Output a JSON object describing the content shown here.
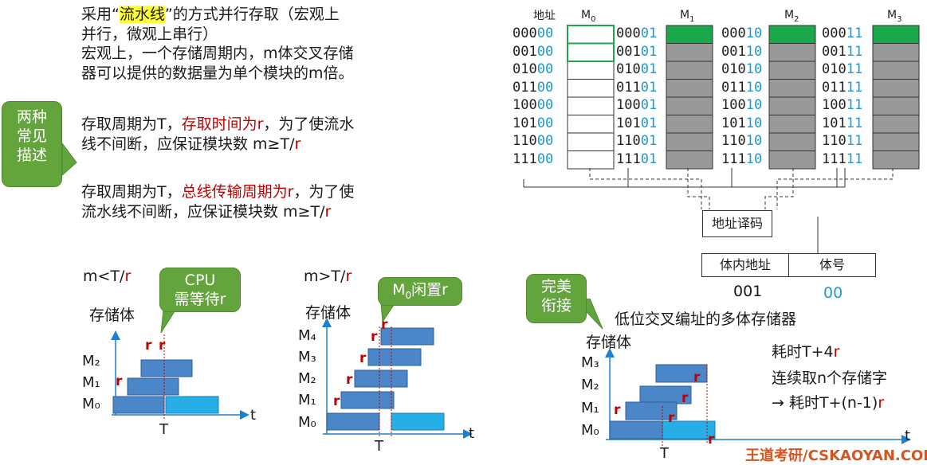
{
  "para1_pre": "采用“",
  "para1_hl": "流水线",
  "para1_post": "”的方式并行存取（宏观上",
  "para1_line2": "并行，微观上串行）",
  "para2_line1": "宏观上，一个存储周期内，m体交叉存储",
  "para2_line2": "器可以提供的数据量为单个模块的m倍。",
  "para3_pre": "存取周期为T，",
  "para3_red": "存取时间为r",
  "para3_post": "，为了使流水",
  "para3_line2_pre": "线不间断，应保证模块数 m≥T/",
  "para3_line2_red": "r",
  "para4_pre": "存取周期为T，",
  "para4_red": "总线传输周期为r",
  "para4_post": "，为了使",
  "para4_line2_pre": "流水线不间断，应保证模块数 m≥T/",
  "para4_line2_red": "r",
  "bubble_desc": [
    "两种",
    "常见",
    "描述"
  ],
  "tl1": {
    "cond_pre": "m<T/",
    "cond_red": "r",
    "bubble": [
      "CPU",
      "需等待r"
    ],
    "title": "存储体",
    "modules": [
      "M₂",
      "M₁",
      "M₀"
    ],
    "r": "r",
    "t": "t",
    "T": "T"
  },
  "tl2": {
    "cond_pre": "m>T/",
    "cond_red": "r",
    "bubble_pre": "M",
    "bubble_sub": "0",
    "bubble_post": "闲置r",
    "title": "存储体",
    "modules": [
      "M₄",
      "M₃",
      "M₂",
      "M₁",
      "M₀"
    ],
    "r": "r",
    "t": "t",
    "T": "T"
  },
  "mem": {
    "header": "地址",
    "modules": [
      "M",
      "M",
      "M",
      "M"
    ],
    "module_subs": [
      "0",
      "1",
      "2",
      "3"
    ],
    "high_bits": [
      "000",
      "001",
      "010",
      "011",
      "100",
      "101",
      "110",
      "111"
    ],
    "low_bits": [
      "00",
      "01",
      "10",
      "11"
    ],
    "decoder": "地址译码",
    "field_in": "体内地址",
    "field_bank": "体号",
    "val_in": "001",
    "val_bank": "00",
    "caption": "低位交叉编址的多体存储器"
  },
  "tl3": {
    "bubble": [
      "完美",
      "衔接"
    ],
    "title": "存储体",
    "modules": [
      "M₃",
      "M₂",
      "M₁",
      "M₀"
    ],
    "r": "r",
    "t": "t",
    "T": "T",
    "note1_pre": "耗时T+4",
    "note1_red": "r",
    "note2": "连续取n个存储字",
    "note3_pre": "→ 耗时T+(n-1)",
    "note3_red": "r"
  },
  "watermark": "王道考研/CSKAOYAN.COM",
  "colors": {
    "bar": "#4a86c8",
    "bar_light": "#27aee6",
    "accent": "#c00000",
    "green": "#1aa84a",
    "bubble": "#63a53c",
    "gray": "#999999",
    "addr_low": "#1c9ad6"
  }
}
